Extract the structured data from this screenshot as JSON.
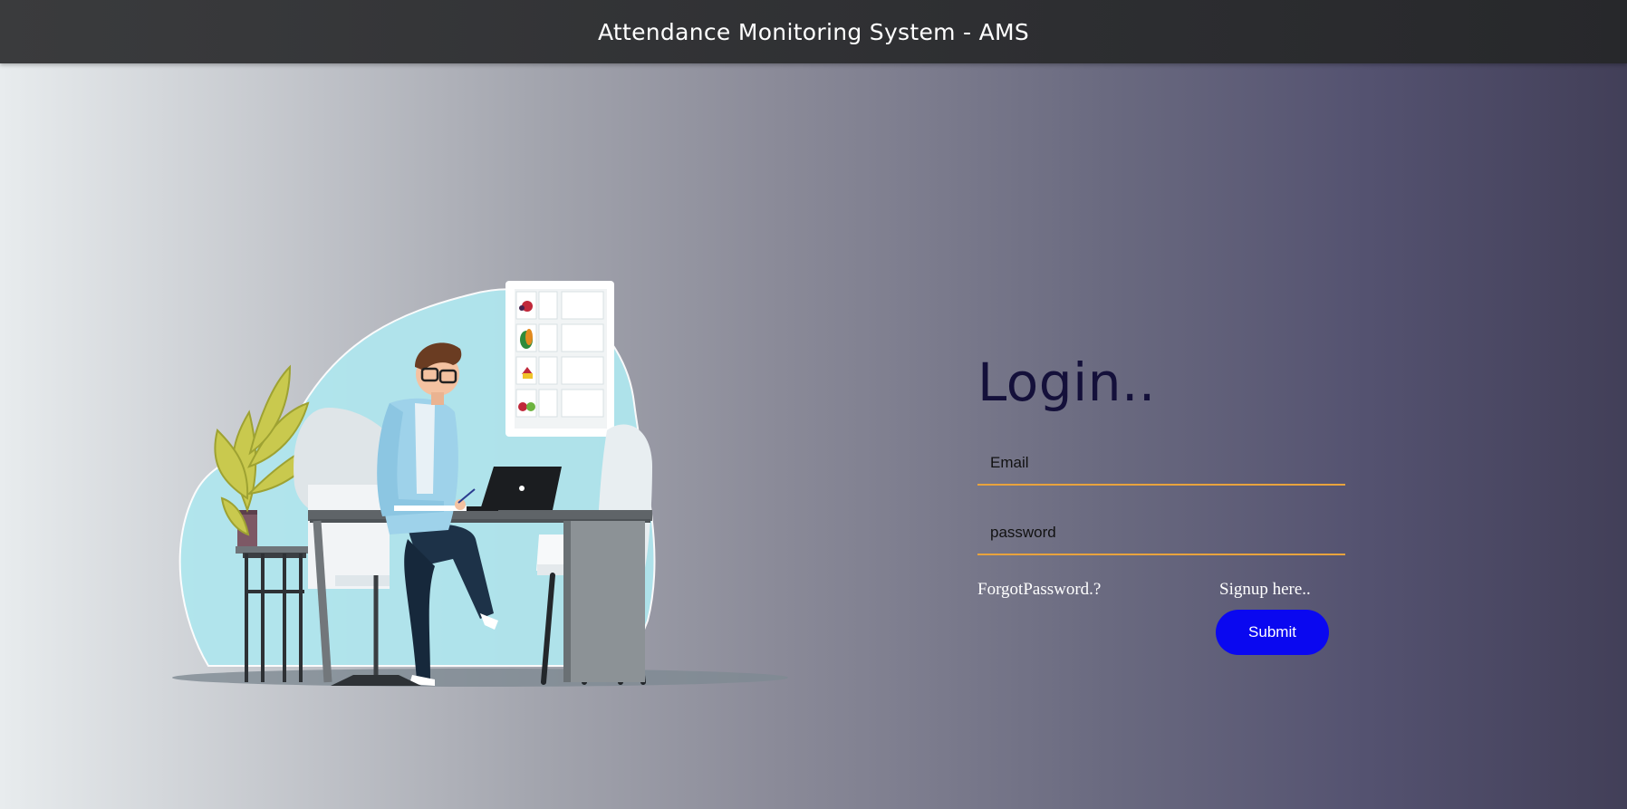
{
  "header": {
    "title": "Attendance Monitoring System - AMS"
  },
  "login": {
    "title": "Login..",
    "email_placeholder": "Email",
    "password_placeholder": "password",
    "forgot_label": "ForgotPassword.?",
    "signup_label": "Signup here..",
    "submit_label": "Submit"
  },
  "colors": {
    "header_bg": "#2e2f32",
    "title_color": "#14103a",
    "field_underline": "#e8a33d",
    "submit_bg": "#0a08f0"
  },
  "illustration": {
    "icon": "person-at-desk-illustration"
  }
}
